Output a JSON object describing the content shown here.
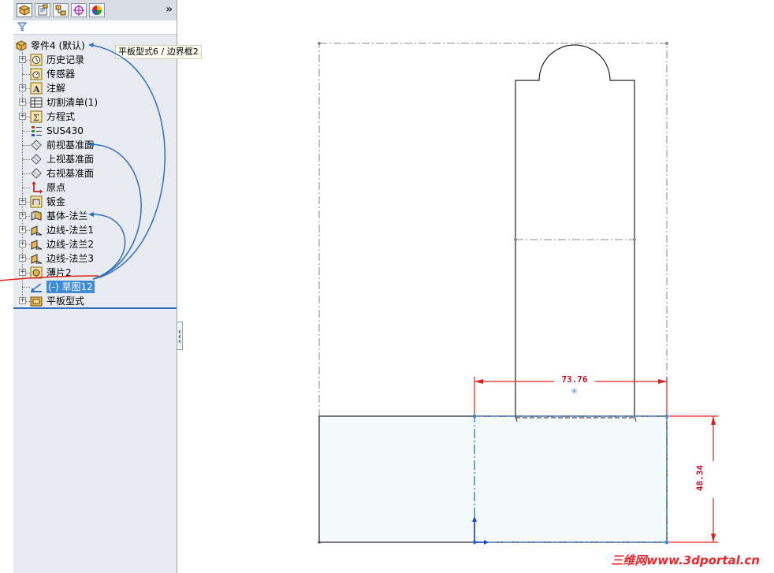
{
  "panel": {
    "tabs": [
      "feature-manager",
      "property-manager",
      "configuration-manager",
      "dimxpert-manager",
      "display-manager"
    ],
    "more_label": "»"
  },
  "tree": {
    "root_label": "零件4 (默认)",
    "items": [
      {
        "label": "历史记录",
        "icon": "history-icon",
        "expandable": true
      },
      {
        "label": "传感器",
        "icon": "sensor-icon",
        "expandable": false
      },
      {
        "label": "注解",
        "icon": "annotation-icon",
        "expandable": true
      },
      {
        "label": "切割清单(1)",
        "icon": "cut-list-icon",
        "expandable": true
      },
      {
        "label": "方程式",
        "icon": "equation-icon",
        "expandable": true
      },
      {
        "label": "SUS430",
        "icon": "material-icon",
        "expandable": false
      },
      {
        "label": "前视基准面",
        "icon": "plane-icon",
        "expandable": false
      },
      {
        "label": "上视基准面",
        "icon": "plane-icon",
        "expandable": false
      },
      {
        "label": "右视基准面",
        "icon": "plane-icon",
        "expandable": false
      },
      {
        "label": "原点",
        "icon": "origin-icon",
        "expandable": false
      },
      {
        "label": "钣金",
        "icon": "sheet-metal-icon",
        "expandable": true
      },
      {
        "label": "基体-法兰",
        "icon": "base-flange-icon",
        "expandable": true
      },
      {
        "label": "边线-法兰1",
        "icon": "edge-flange-icon",
        "expandable": true
      },
      {
        "label": "边线-法兰2",
        "icon": "edge-flange-icon",
        "expandable": true
      },
      {
        "label": "边线-法兰3",
        "icon": "edge-flange-icon",
        "expandable": true
      },
      {
        "label": "薄片2",
        "icon": "tab-feature-icon",
        "expandable": true
      },
      {
        "label": "(-) 草图12",
        "icon": "sketch-icon",
        "expandable": false,
        "selected": true
      },
      {
        "label": "平板型式",
        "icon": "flat-pattern-icon",
        "expandable": true
      }
    ]
  },
  "tooltip": "平板型式6 / 边界框2",
  "dimensions": {
    "horizontal": "73.76",
    "vertical": "48.34"
  },
  "watermark": "三维网www.3dportal.cn",
  "colors": {
    "dimension": "#e0201c",
    "selection": "#3e8ad6",
    "sketch_blue": "#4a86c8",
    "annotation_arc": "#2f6fc0",
    "panel_bg": "#e8ebf0",
    "part_fill": "#f4fbfd"
  }
}
